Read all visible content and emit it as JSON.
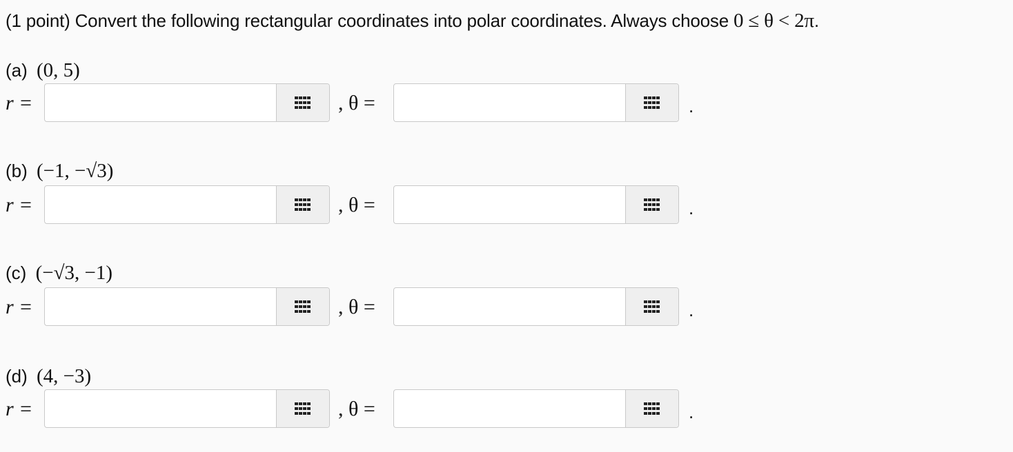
{
  "header": {
    "text": "(1 point) Convert the following rectangular coordinates into polar coordinates. Always choose",
    "constraint": "0 ≤ θ < 2π",
    "period": "."
  },
  "labels": {
    "r": "r =",
    "theta": ", θ =",
    "end": "."
  },
  "parts": [
    {
      "letter": "(a)",
      "point": "(0, 5)",
      "r_value": "",
      "theta_value": ""
    },
    {
      "letter": "(b)",
      "point": "(−1, −√3)",
      "r_value": "",
      "theta_value": ""
    },
    {
      "letter": "(c)",
      "point": "(−√3, −1)",
      "r_value": "",
      "theta_value": ""
    },
    {
      "letter": "(d)",
      "point": "(4, −3)",
      "r_value": "",
      "theta_value": ""
    }
  ],
  "icons": {
    "keyboard_button": "grid-keypad-icon"
  }
}
